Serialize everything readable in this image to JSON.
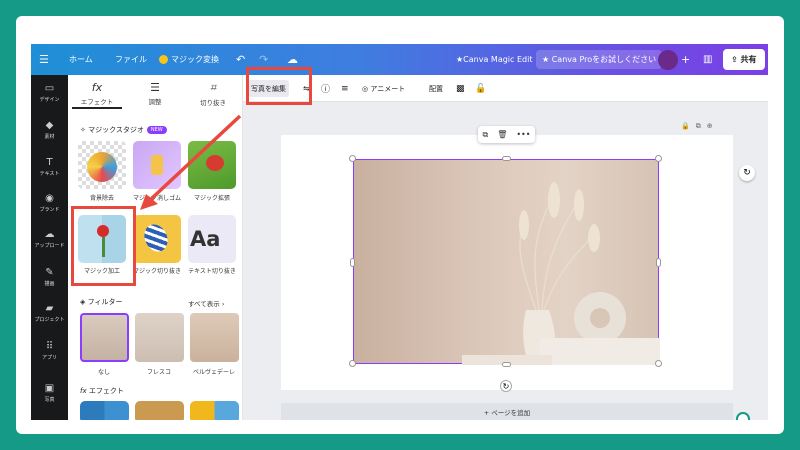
{
  "topbar": {
    "home": "ホーム",
    "file": "ファイル",
    "magic_switch": "マジック変換",
    "magic_edit": "★Canva Magic Edit",
    "pro_trial": "★ Canva Proをお試しください",
    "share": "共有"
  },
  "rail": {
    "items": [
      "デザイン",
      "素材",
      "テキスト",
      "ブランド",
      "アップロード",
      "描画",
      "プロジェクト",
      "アプリ",
      "写真"
    ]
  },
  "panel": {
    "tabs": [
      "エフェクト",
      "調整",
      "切り抜き"
    ],
    "magic_studio": {
      "title": "マジックスタジオ",
      "badge": "NEW"
    },
    "tools": [
      "背景除去",
      "マジック消しゴム",
      "マジック拡張",
      "マジック加工",
      "マジック切り抜き",
      "テキスト切り抜き"
    ],
    "filters": {
      "title": "フィルター",
      "see_all": "すべて表示",
      "items": [
        "なし",
        "フレスコ",
        "ベルヴェデーレ"
      ]
    },
    "effects": {
      "title": "エフェクト"
    }
  },
  "context_toolbar": {
    "edit_photo": "写真を編集",
    "animate": "アニメート",
    "arrange": "配置"
  },
  "canvas": {
    "add_page": "+ ページを追加"
  },
  "colors": {
    "accent": "#8b3dff",
    "annotation": "#e8493f",
    "frame": "#149a86"
  }
}
